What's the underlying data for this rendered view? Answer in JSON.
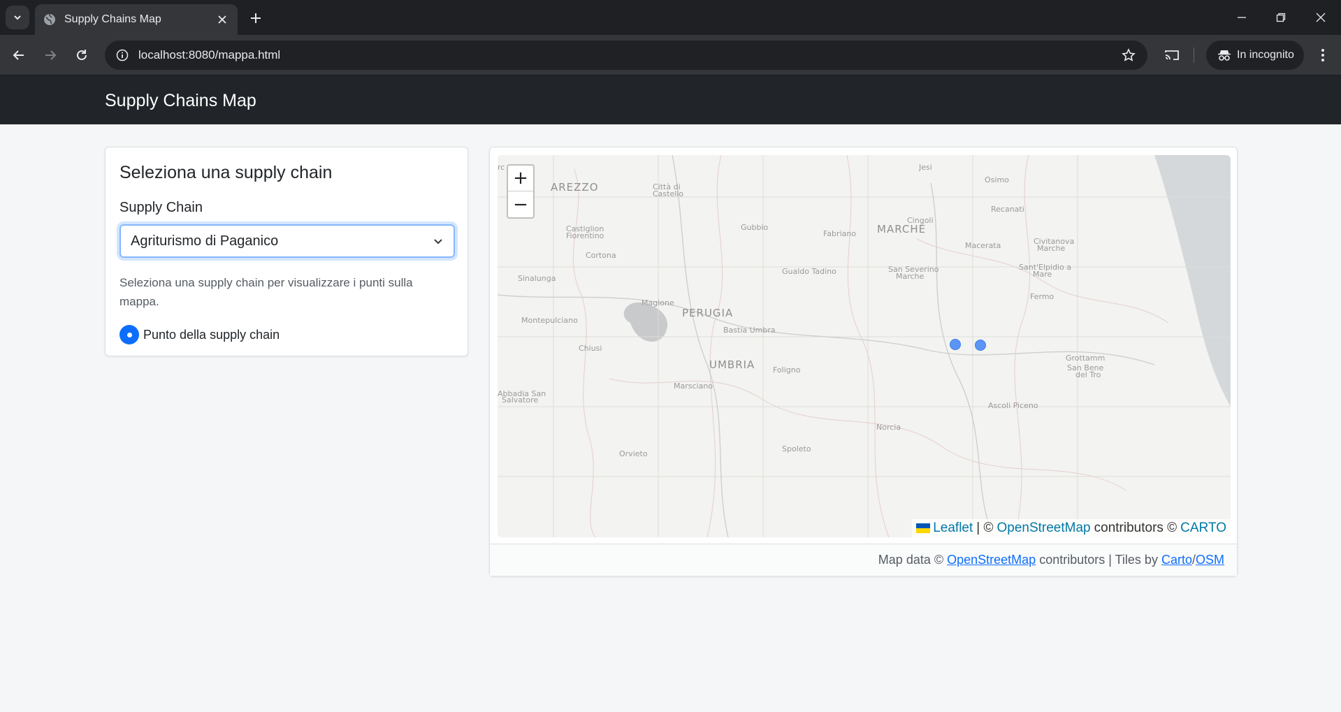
{
  "browser": {
    "tab_title": "Supply Chains Map",
    "url": "localhost:8080/mappa.html",
    "incognito_label": "In incognito"
  },
  "app": {
    "brand": "Supply Chains Map"
  },
  "sidebar": {
    "title": "Seleziona una supply chain",
    "field_label": "Supply Chain",
    "selected_value": "Agriturismo di Paganico",
    "help_text": "Seleziona una supply chain per visualizzare i punti sulla mappa.",
    "legend_label": "Punto della supply chain",
    "accent_color": "#0d6efd"
  },
  "map": {
    "zoom_in": "+",
    "zoom_out": "−",
    "marker_color": "#5b95f5",
    "labels": {
      "arezzo": "AREZZO",
      "citta_castello_1": "Città di",
      "citta_castello_2": "Castello",
      "jesi": "Jesi",
      "osimo": "Osimo",
      "recanati": "Recanati",
      "cingoli": "Cingoli",
      "marche": "MARCHE",
      "castiglion_1": "Castiglion",
      "castiglion_2": "Fiorentino",
      "gubbio": "Gubbio",
      "fabriano": "Fabriano",
      "macerata": "Macerata",
      "civitanova_1": "Civitanova",
      "civitanova_2": "Marche",
      "cortona": "Cortona",
      "santelpidio_1": "Sant'Elpidio a",
      "santelpidio_2": "Mare",
      "gualdo": "Gualdo Tadino",
      "sanseverino_1": "San Severino",
      "sanseverino_2": "Marche",
      "sinalunga": "Sinalunga",
      "magione": "Magione",
      "fermo": "Fermo",
      "perugia": "PERUGIA",
      "montepulciano": "Montepulciano",
      "bastia": "Bastia Umbra",
      "chiusi": "Chiusi",
      "grottammare": "Grottamm",
      "sanbenedetto_1": "San Bene",
      "sanbenedetto_2": "del Tro",
      "umbria": "UMBRIA",
      "foligno": "Foligno",
      "abbadia_1": "Abbadia San",
      "abbadia_2": "Salvatore",
      "marsciano": "Marsciano",
      "ascoli": "Ascoli Piceno",
      "norcia": "Norcia",
      "spoleto": "Spoleto",
      "orvieto": "Orvieto",
      "rc": "rc"
    },
    "attribution": {
      "leaflet": "Leaflet",
      "sep": "| ©",
      "osm": "OpenStreetMap",
      "contributors": "contributors ©",
      "carto": "CARTO"
    }
  },
  "footer": {
    "prefix": "Map data ©",
    "osm": "OpenStreetMap",
    "middle": "contributors | Tiles by",
    "carto": "Carto",
    "slash": "/",
    "osm2": "OSM"
  }
}
